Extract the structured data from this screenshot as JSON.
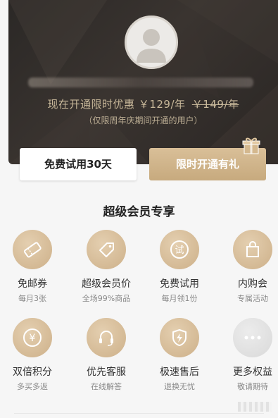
{
  "hero": {
    "promo_prefix": "现在开通限时优惠",
    "promo_price": "￥129/年",
    "promo_old_price": "￥149/年",
    "promo_note": "（仅限周年庆期间开通的用户）"
  },
  "actions": {
    "trial_label": "免费试用30天",
    "gift_label": "限时开通有礼"
  },
  "section": {
    "title": "超级会员专享"
  },
  "benefits": [
    {
      "icon": "ticket-icon",
      "name": "免邮券",
      "sub": "每月3张"
    },
    {
      "icon": "price-tag-icon",
      "name": "超级会员价",
      "sub": "全场99%商品"
    },
    {
      "icon": "trial-icon",
      "glyph": "试",
      "name": "免费试用",
      "sub": "每月领1份"
    },
    {
      "icon": "shopping-bag-icon",
      "name": "内购会",
      "sub": "专属活动"
    },
    {
      "icon": "yuan-icon",
      "glyph": "¥",
      "name": "双倍积分",
      "sub": "多买多返"
    },
    {
      "icon": "headset-icon",
      "name": "优先客服",
      "sub": "在线解答"
    },
    {
      "icon": "lightning-shield-icon",
      "name": "极速售后",
      "sub": "退换无忧"
    },
    {
      "icon": "more-dots-icon",
      "name": "更多权益",
      "sub": "敬请期待"
    }
  ],
  "colors": {
    "gold": "#cdb089",
    "dark": "#2b2826"
  }
}
